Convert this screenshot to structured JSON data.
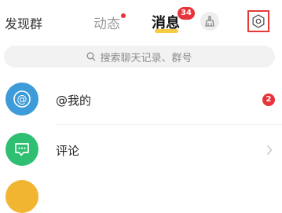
{
  "header": {
    "discover_label": "发现群",
    "tabs": [
      {
        "label": "动态",
        "has_dot": true
      },
      {
        "label": "消息",
        "badge": "34",
        "active": true
      }
    ],
    "clean_button_icon": "broom-icon",
    "settings_button_icon": "gear-icon"
  },
  "search": {
    "placeholder": "搜索聊天记录、群号",
    "icon": "search-icon"
  },
  "list": [
    {
      "label": "@我的",
      "icon": "at-sign-icon",
      "color": "#3d9bd9",
      "badge": "2"
    },
    {
      "label": "评论",
      "icon": "comment-icon",
      "color": "#2fbf72",
      "chevron": "›"
    },
    {
      "label": "",
      "icon": "unknown-icon",
      "color": "#f2b531"
    }
  ],
  "colors": {
    "accent_red": "#e8333a",
    "tab_underline": "#f5c52e",
    "settings_highlight": "#e53935"
  }
}
